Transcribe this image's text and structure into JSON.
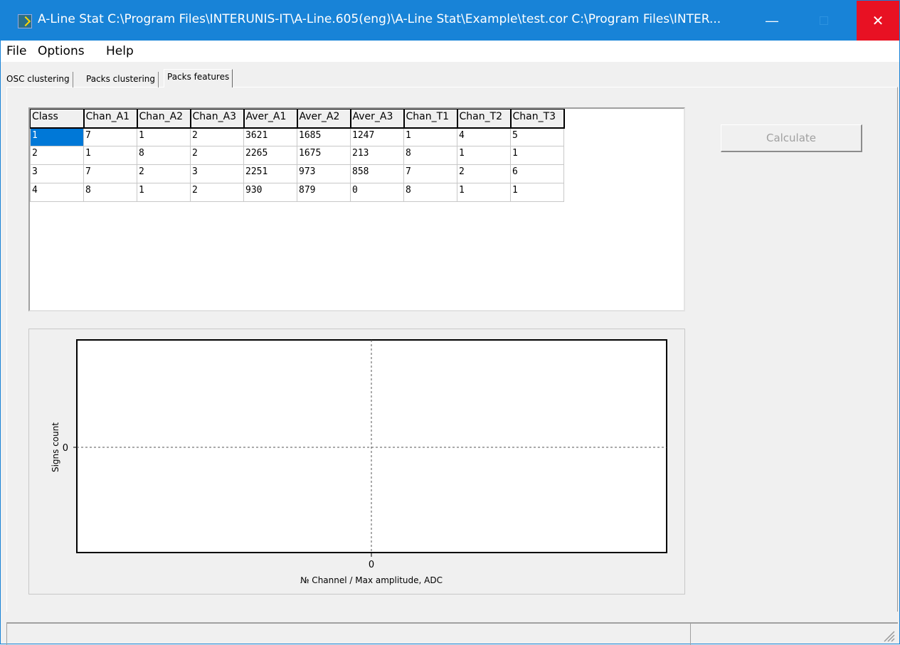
{
  "window": {
    "title": "A-Line Stat  C:\\Program Files\\INTERUNIS-IT\\A-Line.605(eng)\\A-Line Stat\\Example\\test.cor  C:\\Program Files\\INTER...",
    "minimize": "—",
    "close": "✕"
  },
  "menu": {
    "file": "File",
    "options": "Options",
    "help": "Help"
  },
  "tabs": {
    "osc": "OSC clustering",
    "packs_clustering": "Packs clustering",
    "packs_features": "Packs features"
  },
  "table": {
    "headers": [
      "Class",
      "Chan_A1",
      "Chan_A2",
      "Chan_A3",
      "Aver_A1",
      "Aver_A2",
      "Aver_A3",
      "Chan_T1",
      "Chan_T2",
      "Chan_T3"
    ],
    "rows": [
      [
        "1",
        "7",
        "1",
        "2",
        "3621",
        "1685",
        "1247",
        "1",
        "4",
        "5"
      ],
      [
        "2",
        "1",
        "8",
        "2",
        "2265",
        "1675",
        "213",
        "8",
        "1",
        "1"
      ],
      [
        "3",
        "7",
        "2",
        "3",
        "2251",
        "973",
        "858",
        "7",
        "2",
        "6"
      ],
      [
        "4",
        "8",
        "1",
        "2",
        "930",
        "879",
        "0",
        "8",
        "1",
        "1"
      ]
    ]
  },
  "calculate_label": "Calculate",
  "chart_data": {
    "type": "bar",
    "xlabel": "№ Channel / Max amplitude, ADC",
    "ylabel": "Signs count",
    "x_ticks": [
      "0"
    ],
    "y_ticks": [
      "0"
    ],
    "series": [],
    "grid": true
  },
  "colors": {
    "titlebar": "#1883d7",
    "close": "#e81123",
    "selection": "#0078d7"
  }
}
